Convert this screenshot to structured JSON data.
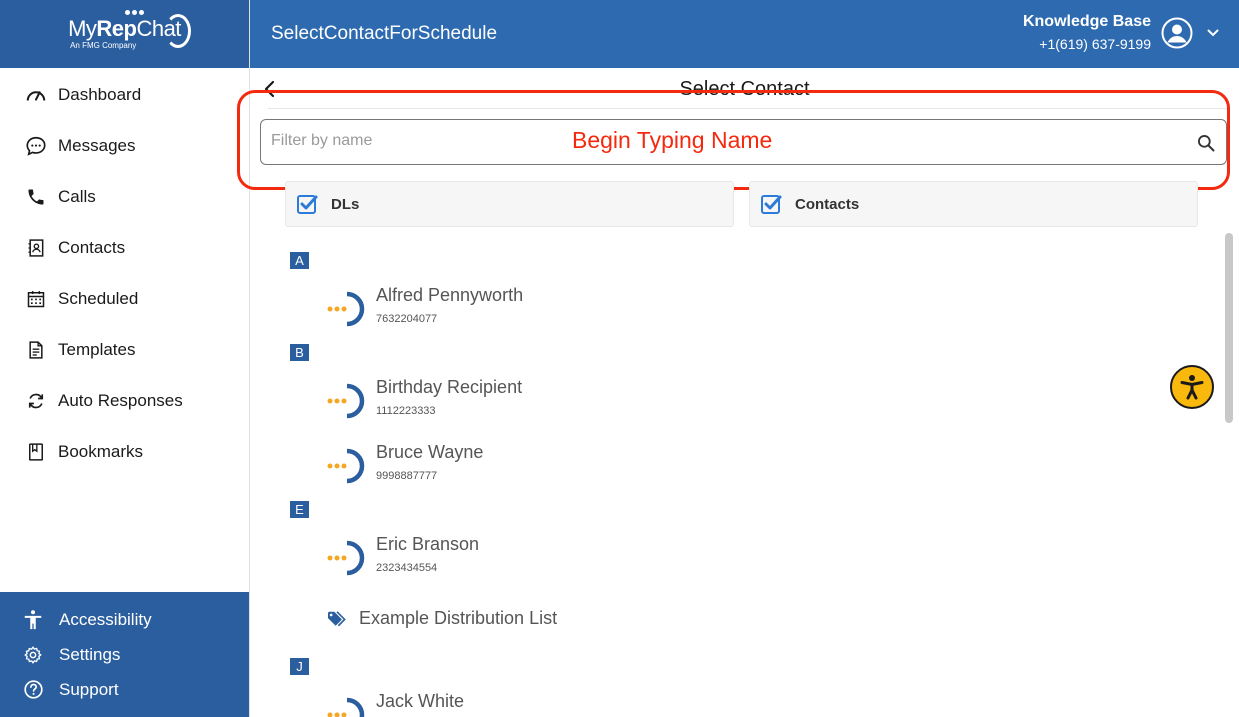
{
  "logo": {
    "brand_light": "My",
    "brand_bold": "Rep",
    "brand_end": "Chat",
    "tagline": "An FMG Company"
  },
  "sidebar": {
    "items": [
      {
        "label": "Dashboard",
        "icon": "dashboard-icon"
      },
      {
        "label": "Messages",
        "icon": "chat-bubble-icon"
      },
      {
        "label": "Calls",
        "icon": "phone-icon"
      },
      {
        "label": "Contacts",
        "icon": "contacts-icon"
      },
      {
        "label": "Scheduled",
        "icon": "calendar-icon"
      },
      {
        "label": "Templates",
        "icon": "document-icon"
      },
      {
        "label": "Auto Responses",
        "icon": "refresh-icon"
      },
      {
        "label": "Bookmarks",
        "icon": "bookmark-icon"
      }
    ],
    "bottom": [
      {
        "label": "Accessibility",
        "icon": "accessibility-icon"
      },
      {
        "label": "Settings",
        "icon": "gear-icon"
      },
      {
        "label": "Support",
        "icon": "help-icon"
      }
    ]
  },
  "header": {
    "title": "SelectContactForSchedule",
    "account_name": "Knowledge Base",
    "account_phone": "+1(619) 637-9199"
  },
  "main": {
    "title": "Select Contact",
    "filter_placeholder": "Filter by name",
    "annotation": "Begin Typing Name",
    "toggles": [
      {
        "label": "DLs",
        "checked": true
      },
      {
        "label": "Contacts",
        "checked": true
      }
    ],
    "groups": [
      {
        "letter": "A",
        "entries": [
          {
            "name": "Alfred Pennyworth",
            "phone": "7632204077"
          }
        ]
      },
      {
        "letter": "B",
        "entries": [
          {
            "name": "Birthday Recipient",
            "phone": "1112223333"
          },
          {
            "name": "Bruce Wayne",
            "phone": "9998887777"
          }
        ]
      },
      {
        "letter": "E",
        "entries": [
          {
            "name": "Eric Branson",
            "phone": "2323434554"
          }
        ],
        "distribution_lists": [
          {
            "name": "Example Distribution List"
          }
        ]
      },
      {
        "letter": "J",
        "entries": [
          {
            "name": "Jack White",
            "phone": ""
          }
        ]
      }
    ]
  },
  "colors": {
    "primary": "#2b5e9e",
    "header": "#2d6aaf",
    "annotation": "#f42a0f",
    "accent_orange": "#f5a623",
    "fab": "#f8b80c"
  }
}
